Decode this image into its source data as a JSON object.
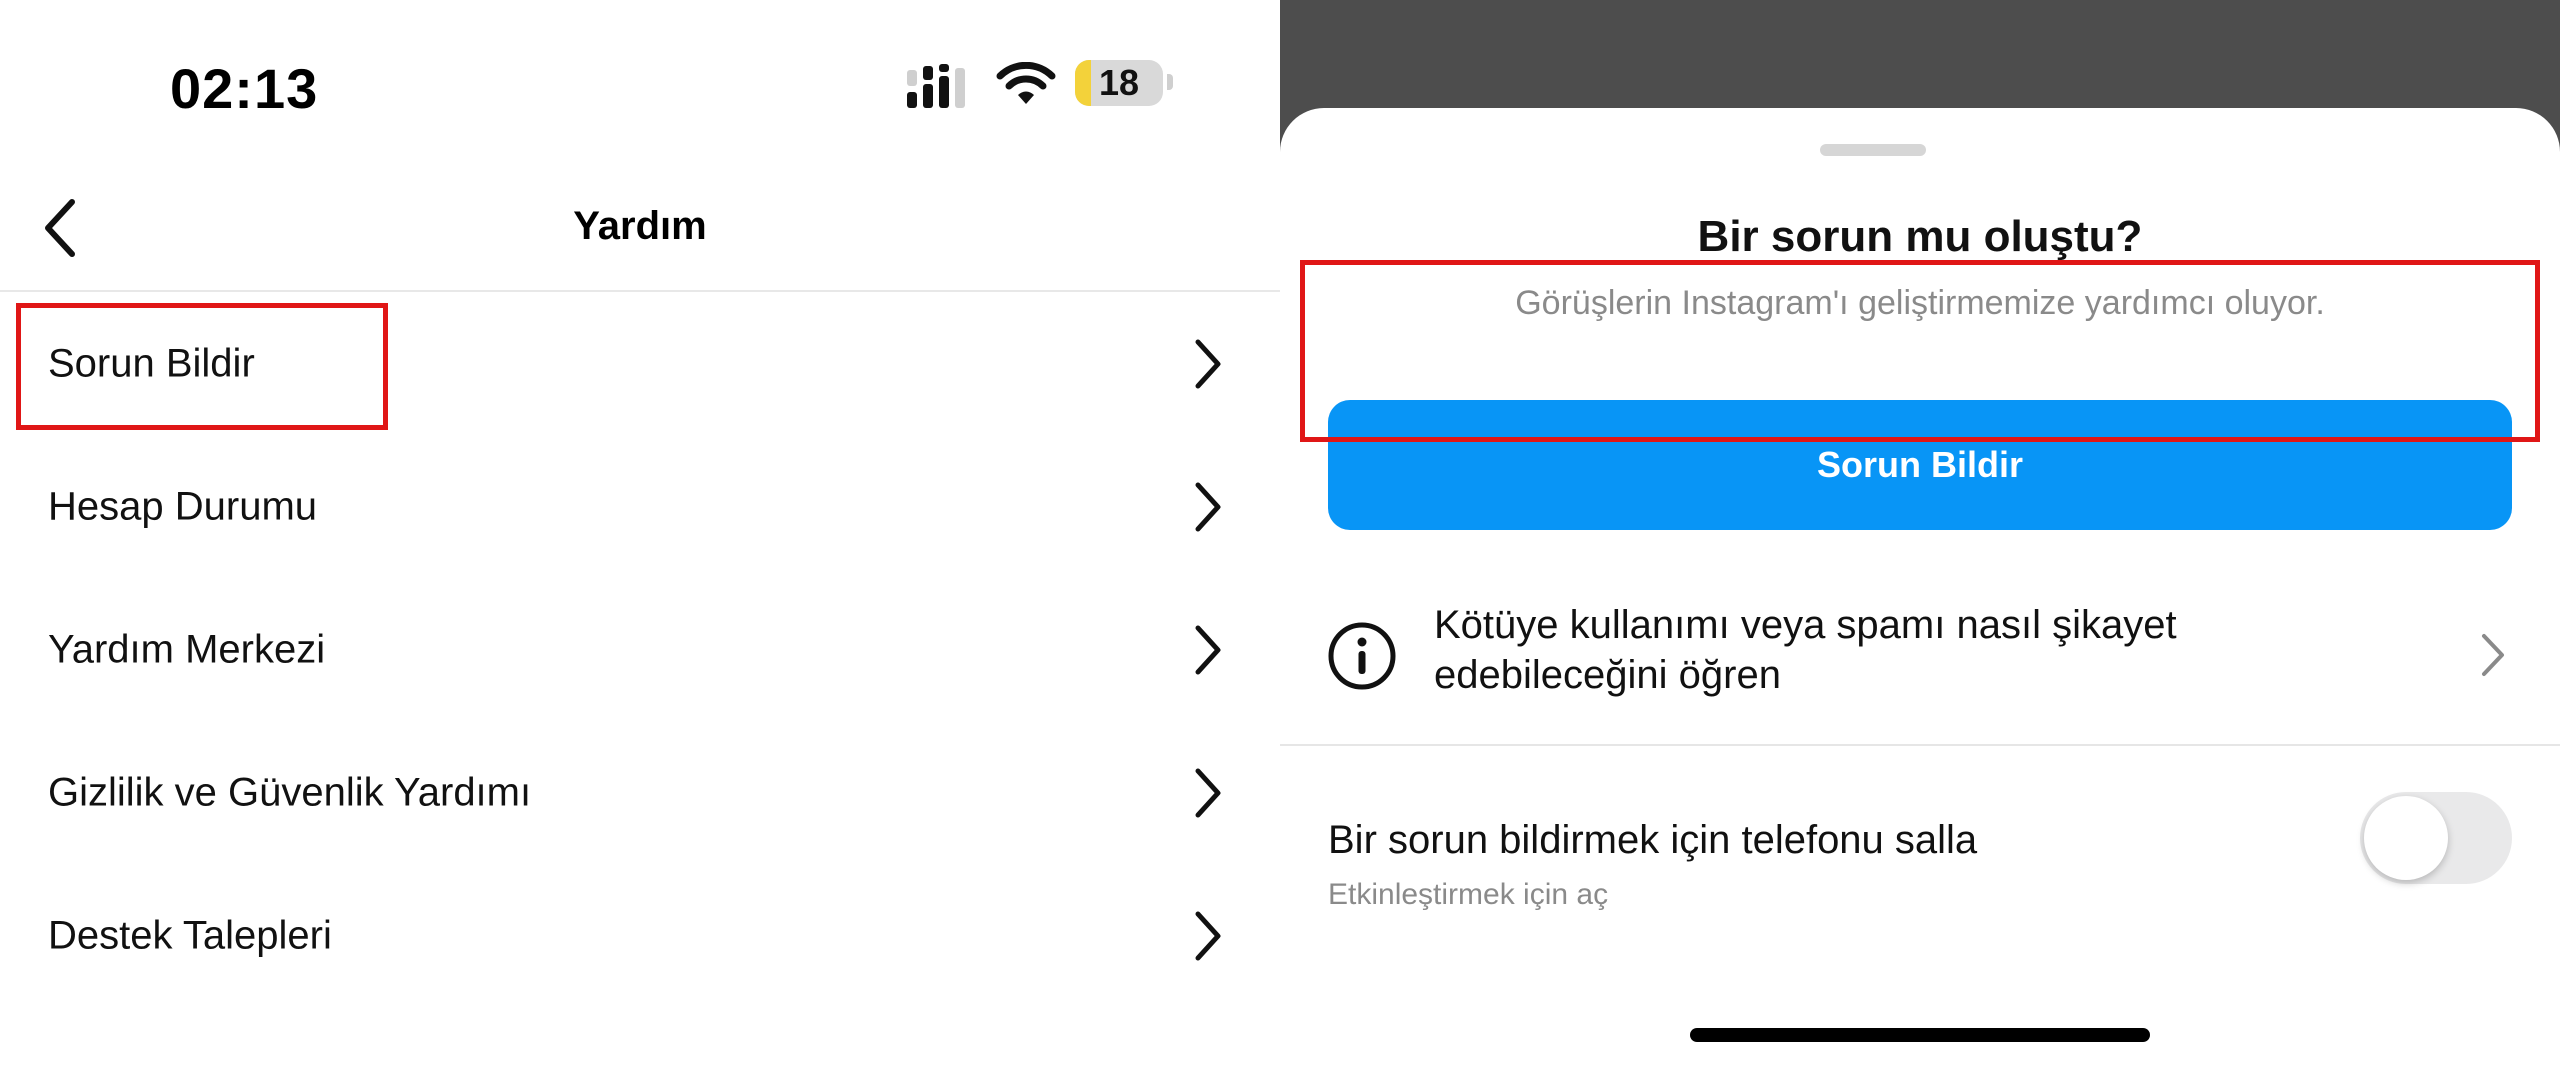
{
  "status_bar": {
    "time": "02:13",
    "battery_level": "18",
    "battery_fraction": 0.18,
    "icons": [
      "cellular-signal-icon",
      "wifi-icon",
      "battery-icon"
    ]
  },
  "help_screen": {
    "title": "Yardım",
    "back_icon": "chevron-left-icon",
    "items": [
      {
        "label": "Sorun Bildir"
      },
      {
        "label": "Hesap Durumu"
      },
      {
        "label": "Yardım Merkezi"
      },
      {
        "label": "Gizlilik ve Güvenlik Yardımı"
      },
      {
        "label": "Destek Talepleri"
      }
    ]
  },
  "report_sheet": {
    "title": "Bir sorun mu oluştu?",
    "subtitle": "Görüşlerin Instagram'ı geliştirmemize yardımcı oluyor.",
    "report_button": "Sorun Bildir",
    "info_link": {
      "icon": "info-icon",
      "line1": "Kötüye kullanımı veya spamı nasıl şikayet",
      "line2": "edebileceğini öğren"
    },
    "shake_setting": {
      "title": "Bir sorun bildirmek için telefonu salla",
      "subtitle": "Etkinleştirmek için aç",
      "enabled": false
    }
  },
  "colors": {
    "accent_blue": "#0895F6",
    "highlight_red": "#E01616",
    "backdrop": "#4D4D4D",
    "battery_yellow": "#F3D23A"
  }
}
